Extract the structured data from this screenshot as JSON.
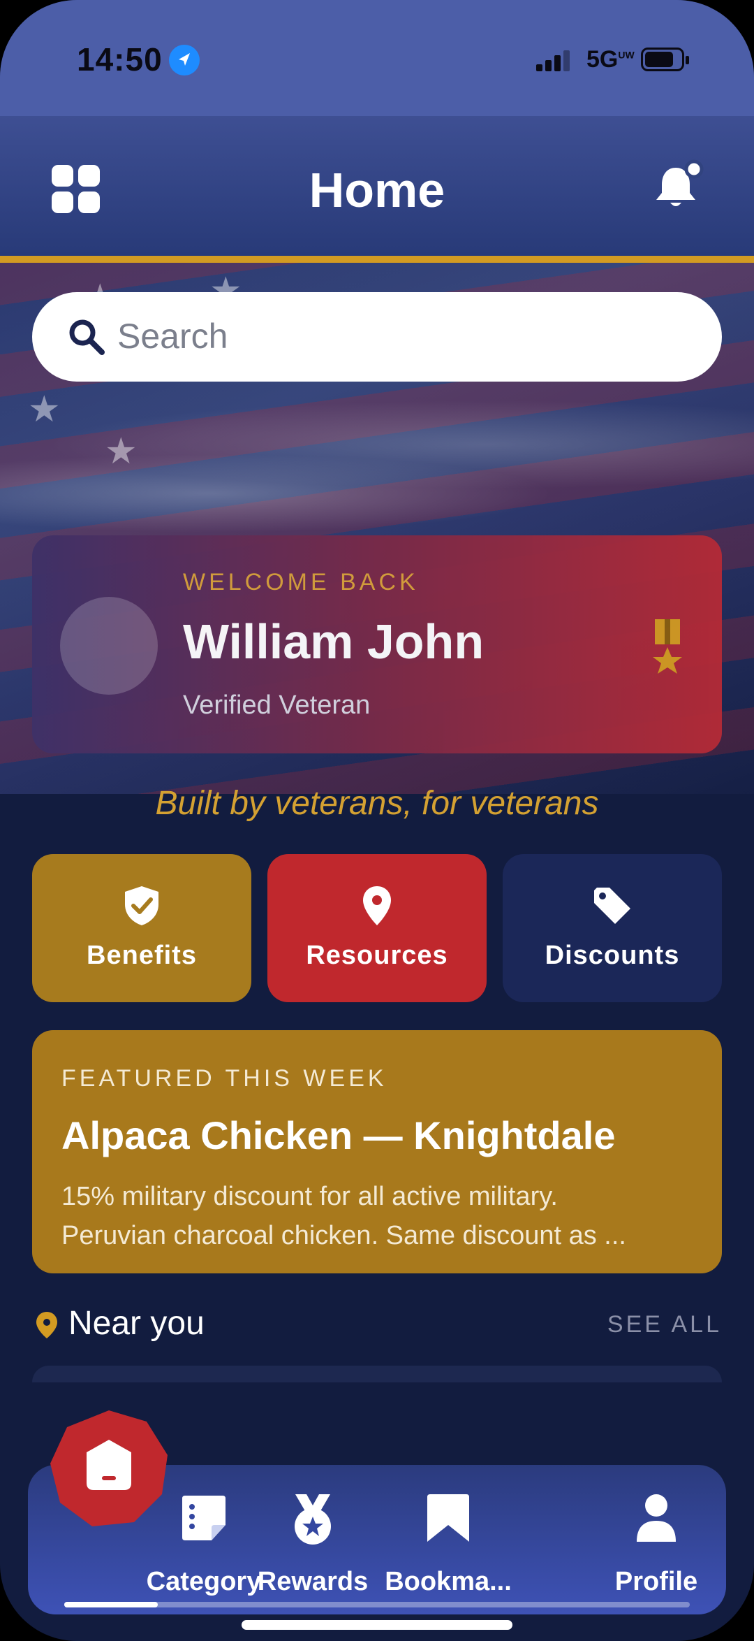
{
  "status_bar": {
    "time": "14:50",
    "network": "5G",
    "network_sup": "UW"
  },
  "header": {
    "title": "Home"
  },
  "search": {
    "placeholder": "Search"
  },
  "welcome": {
    "eyebrow": "WELCOME BACK",
    "name": "William John",
    "status": "Verified Veteran"
  },
  "tagline": "Built by veterans, for veterans",
  "quick_actions": [
    {
      "label": "Benefits",
      "icon": "shield-check-icon",
      "color": "#a77b1e"
    },
    {
      "label": "Resources",
      "icon": "map-pin-icon",
      "color": "#c0282d"
    },
    {
      "label": "Discounts",
      "icon": "tag-icon",
      "color": "#1b2758"
    }
  ],
  "featured": {
    "eyebrow": "FEATURED THIS WEEK",
    "title": "Alpaca Chicken — Knightdale",
    "description_line1": "15% military discount for all active military.",
    "description_line2": "Peruvian charcoal chicken. Same discount as ..."
  },
  "near_you": {
    "title": "Near you",
    "see_all": "SEE ALL"
  },
  "bottom_nav": {
    "items": [
      {
        "label": "Category",
        "icon": "category-icon"
      },
      {
        "label": "Rewards",
        "icon": "medal-icon"
      },
      {
        "label": "Bookma...",
        "icon": "bookmark-icon"
      },
      {
        "label": "Profile",
        "icon": "person-icon"
      }
    ],
    "progress": 0.15
  },
  "colors": {
    "accent_gold": "#d39b22",
    "red": "#c0282d",
    "navy": "#121c3f"
  }
}
